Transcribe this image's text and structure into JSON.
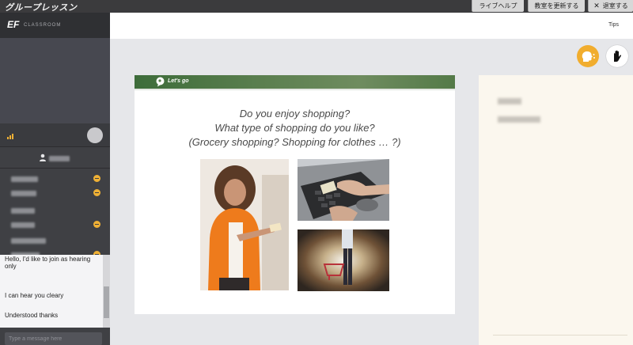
{
  "app": {
    "title": "グループレッスン"
  },
  "topbar": {
    "help_label": "ライブヘルプ",
    "refresh_label": "教室を更新する",
    "leave_icon": "close-icon",
    "leave_label": "退室する"
  },
  "sidebar": {
    "logo_mark": "EF",
    "logo_text": "CLASSROOM"
  },
  "chat": {
    "messages": [
      "Hello, I'd like to join as hearing only",
      "I can hear you cleary",
      "Understood thanks"
    ],
    "input_placeholder": "Type a message here"
  },
  "main": {
    "tips_label": "Tips"
  },
  "slide": {
    "header_label": "Let's go",
    "question_lines": [
      "Do you enjoy shopping?",
      "What type of shopping do you like?",
      "(Grocery shopping? Shopping for clothes … ?)"
    ]
  },
  "colors": {
    "talk_button": "#f1ad2e",
    "badge": "#f0b135",
    "slide_header": "#4f7645",
    "sidebar": "#3f4044"
  }
}
